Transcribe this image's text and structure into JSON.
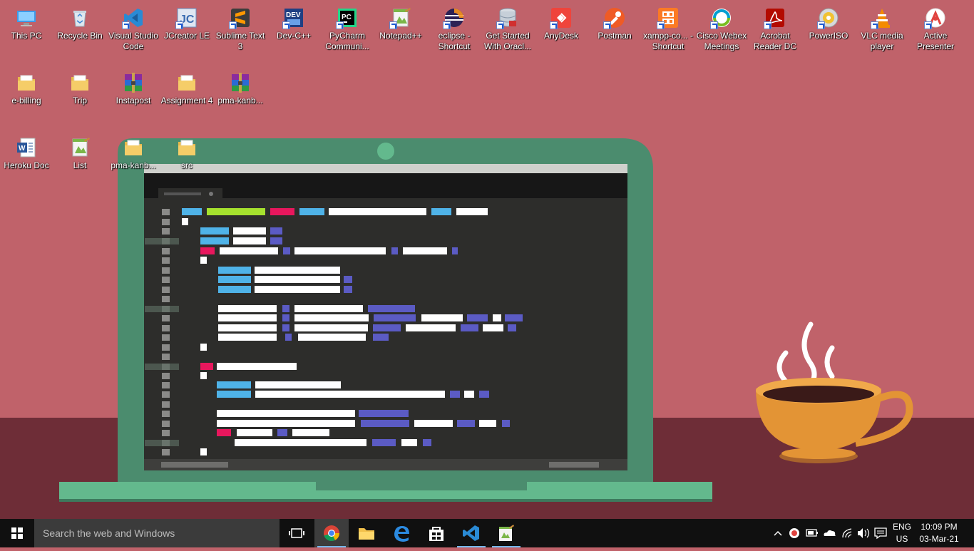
{
  "desktop": {
    "icons": [
      {
        "label": "This PC",
        "icon": "computer-icon",
        "shortcut": false
      },
      {
        "label": "Recycle Bin",
        "icon": "recycle-bin-icon",
        "shortcut": false
      },
      {
        "label": "Visual Studio Code",
        "icon": "vscode-icon",
        "shortcut": true
      },
      {
        "label": "JCreator LE",
        "icon": "jcreator-icon",
        "shortcut": true
      },
      {
        "label": "Sublime Text 3",
        "icon": "sublime-icon",
        "shortcut": true
      },
      {
        "label": "Dev-C++",
        "icon": "devcpp-icon",
        "shortcut": true
      },
      {
        "label": "PyCharm Communi...",
        "icon": "pycharm-icon",
        "shortcut": true
      },
      {
        "label": "Notepad++",
        "icon": "notepadpp-icon",
        "shortcut": true
      },
      {
        "label": "eclipse - Shortcut",
        "icon": "eclipse-icon",
        "shortcut": true
      },
      {
        "label": "Get Started With Oracl...",
        "icon": "oracle-db-icon",
        "shortcut": true
      },
      {
        "label": "AnyDesk",
        "icon": "anydesk-icon",
        "shortcut": true
      },
      {
        "label": "Postman",
        "icon": "postman-icon",
        "shortcut": true
      },
      {
        "label": "xampp-co... - Shortcut",
        "icon": "xampp-icon",
        "shortcut": true
      },
      {
        "label": "Cisco Webex Meetings",
        "icon": "webex-icon",
        "shortcut": true
      },
      {
        "label": "Acrobat Reader DC",
        "icon": "acrobat-icon",
        "shortcut": true
      },
      {
        "label": "PowerISO",
        "icon": "poweriso-icon",
        "shortcut": true
      },
      {
        "label": "VLC media player",
        "icon": "vlc-icon",
        "shortcut": true
      },
      {
        "label": "Active Presenter",
        "icon": "activepresenter-icon",
        "shortcut": true
      },
      {
        "label": "e-billing",
        "icon": "folder-icon",
        "shortcut": false
      },
      {
        "label": "Trip",
        "icon": "folder-icon",
        "shortcut": false
      },
      {
        "label": "Instapost",
        "icon": "winrar-archive-icon",
        "shortcut": false
      },
      {
        "label": "Assignment 4",
        "icon": "folder-icon",
        "shortcut": false
      },
      {
        "label": "pma-kanb...",
        "icon": "winrar-archive-icon",
        "shortcut": false
      },
      {
        "label": "Heroku Doc",
        "icon": "word-doc-icon",
        "shortcut": false
      },
      {
        "label": "List",
        "icon": "notepadpp-file-icon",
        "shortcut": false
      },
      {
        "label": "pma-kanb...",
        "icon": "folder-icon",
        "shortcut": false
      },
      {
        "label": "src",
        "icon": "folder-icon",
        "shortcut": false
      }
    ]
  },
  "taskbar": {
    "search_placeholder": "Search the web and Windows",
    "apps": [
      {
        "name": "task-view",
        "icon": "task-view-icon"
      },
      {
        "name": "chrome",
        "icon": "chrome-icon"
      },
      {
        "name": "file-explorer",
        "icon": "folder-icon"
      },
      {
        "name": "edge",
        "icon": "edge-icon"
      },
      {
        "name": "store",
        "icon": "store-icon"
      },
      {
        "name": "vscode",
        "icon": "vscode-icon"
      },
      {
        "name": "notepadpp",
        "icon": "notepadpp-icon"
      }
    ],
    "tray": {
      "lang_top": "ENG",
      "lang_bottom": "US",
      "time": "10:09 PM",
      "date": "03-Mar-21"
    }
  },
  "colors": {
    "wallpaper": "#c0626a",
    "table": "#6e2d37",
    "laptop": "#4b8c6e",
    "screen": "#2d2d2b",
    "taskbar": "#101010",
    "accent": "#76b9ed"
  }
}
